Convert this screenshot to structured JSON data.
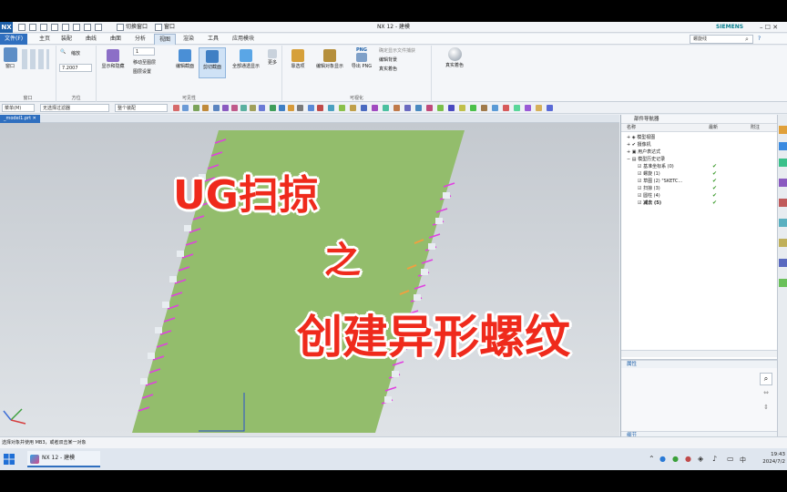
{
  "app": {
    "logo": "NX",
    "title": "NX 12 - 建模",
    "brand": "SIEMENS",
    "switch_window": "切换窗口",
    "window_menu": "窗口"
  },
  "menu": {
    "file": "文件(F)",
    "tabs": [
      "主页",
      "装配",
      "曲线",
      "曲面",
      "分析",
      "视图",
      "渲染",
      "工具",
      "应用模块"
    ],
    "active_tab": "视图",
    "search_placeholder": "螺旋线"
  },
  "ribbon": {
    "window_btn": "窗口",
    "window_group": "窗口",
    "orient_group": "方位",
    "orient_value": "7.2007",
    "orient_icon": "缩放",
    "show_hide": "显示和隐藏",
    "move_to_layer": "移动至图层",
    "layer_settings": "图层设置",
    "edit_section": "编辑截面",
    "clip_section": "剪切截面",
    "show_all_through": "全部通透显示",
    "more": "更多",
    "visibility_group": "可见性",
    "deselect": "靠选项",
    "edit_display": "编辑对象显示",
    "export_png": "导出 PNG",
    "png_label": "PNG",
    "edit_background": "编辑背景",
    "true_shading_small": "真实着色",
    "capture_label": "确定显示文件捕获",
    "true_shading": "真实着色",
    "visualization_group": "可视化"
  },
  "toolbar": {
    "menu": "菜单(M)",
    "filter": "无选择过滤器",
    "assembly": "整个装配"
  },
  "document": {
    "tab": "_model1.prt"
  },
  "navigator": {
    "title": "部件导航器",
    "col_name": "名称",
    "col_latest": "最新",
    "col_note": "附注",
    "rows": [
      {
        "label": "模型视图",
        "check": ""
      },
      {
        "label": "摄像机",
        "check": ""
      },
      {
        "label": "用户表达式",
        "check": ""
      },
      {
        "label": "模型历史记录",
        "check": ""
      },
      {
        "label": "基准坐标系 (0)",
        "check": "✔"
      },
      {
        "label": "螺旋 (1)",
        "check": "✔"
      },
      {
        "label": "草图 (2) \"SKETC...",
        "check": "✔"
      },
      {
        "label": "扫掠 (3)",
        "check": "✔"
      },
      {
        "label": "圆柱 (4)",
        "check": "✔"
      },
      {
        "label": "减去 (5)",
        "check": "✔"
      }
    ],
    "properties": "属性",
    "details": "细节",
    "preview": "预览"
  },
  "status": {
    "text": "选择对象并使用 MB3，或者双击某一对象"
  },
  "overlay": {
    "line1": "UG扫掠",
    "line2": "之",
    "line3": "创建异形螺纹"
  },
  "taskbar": {
    "nx_app": "NX 12 - 建模",
    "ime": "中",
    "time": "19:43",
    "date": "2024/7/2"
  },
  "colors": {
    "part_fill": "#93bd6c",
    "thread_mark": "#e040e0",
    "thread_orange": "#f0a040",
    "overlay_text": "#ef2a1c",
    "accent": "#2f6fbf"
  }
}
